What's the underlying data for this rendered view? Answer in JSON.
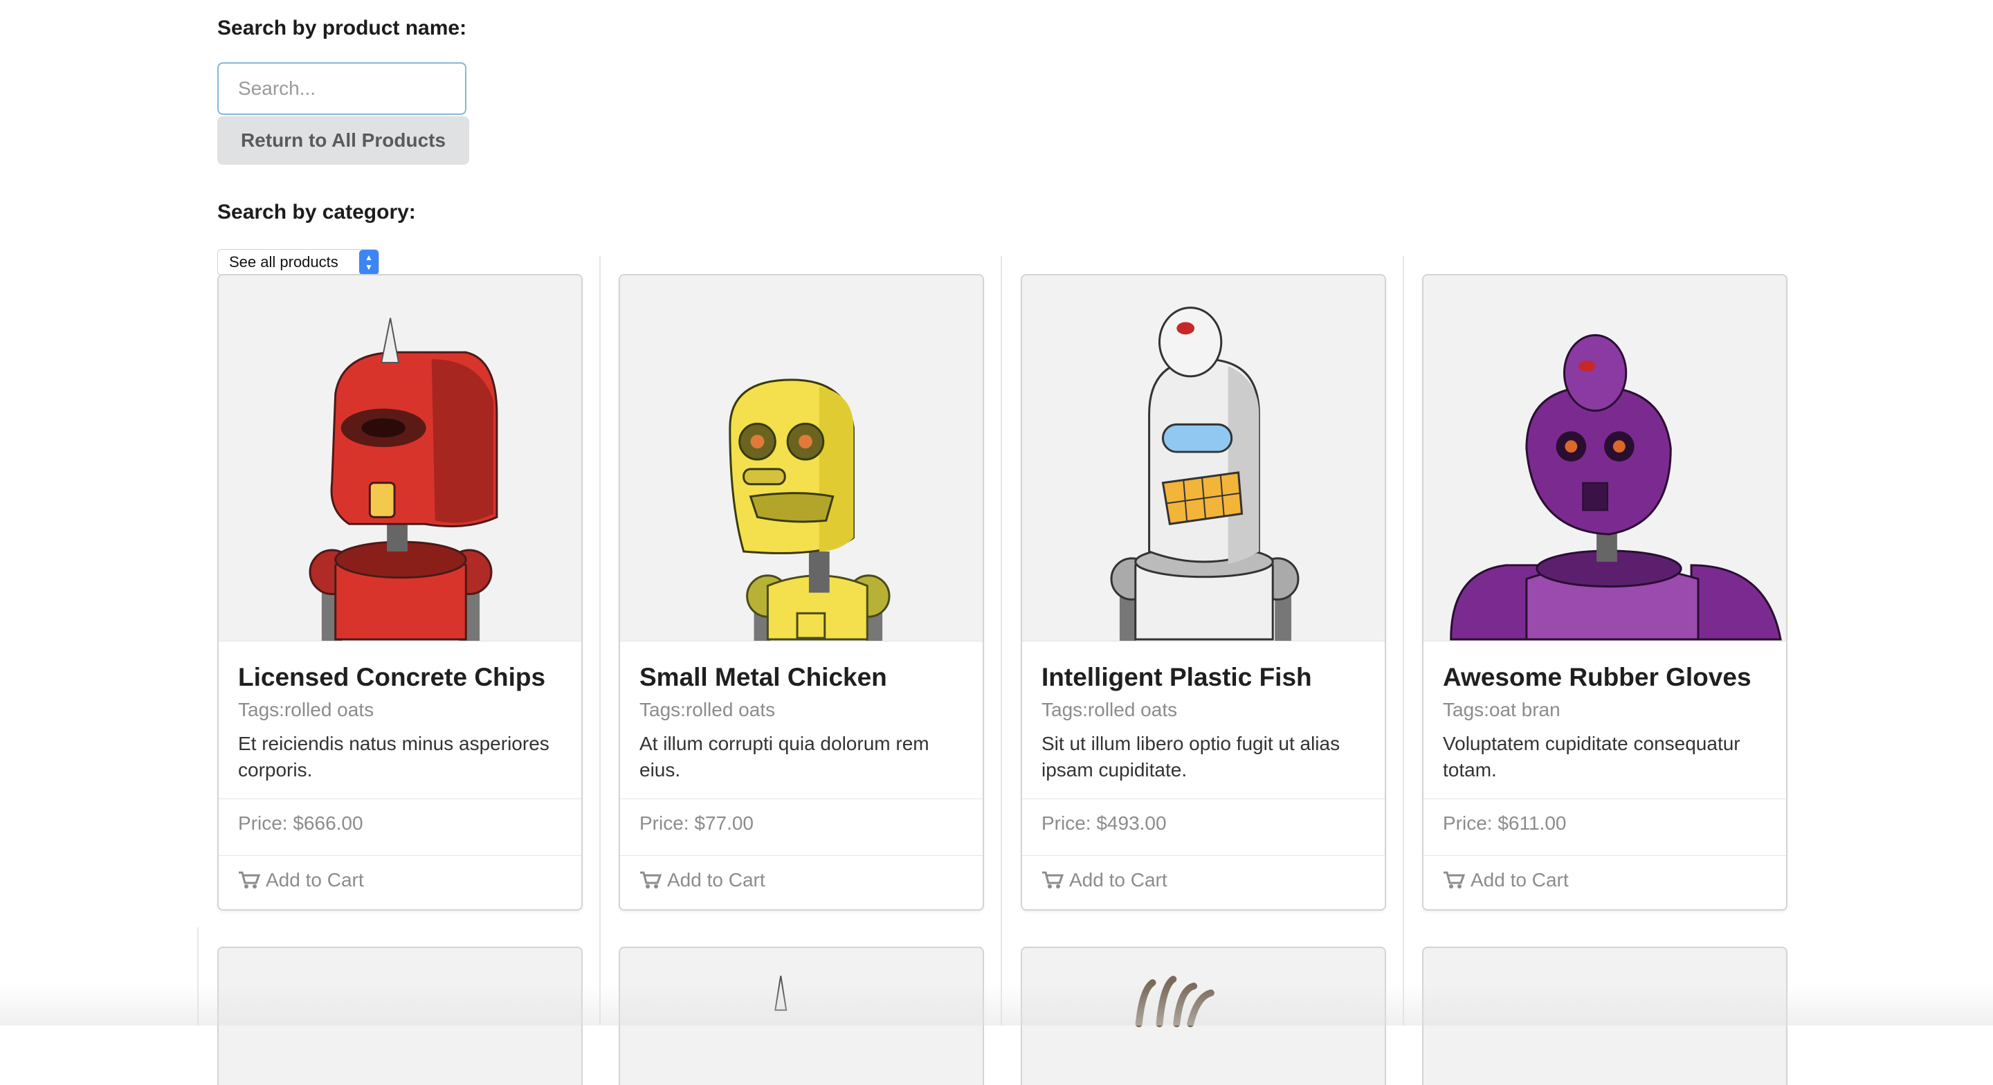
{
  "search": {
    "label": "Search by product name:",
    "placeholder": "Search...",
    "value": "",
    "return_label": "Return to All Products"
  },
  "category": {
    "label": "Search by category:",
    "selected": "See all products"
  },
  "products": [
    {
      "title": "Licensed Concrete Chips",
      "tags": "Tags:rolled oats",
      "description": "Et reiciendis natus minus asperiores corporis.",
      "price": "Price: $666.00",
      "cart_label": "Add to Cart",
      "robot_color": "#d9342b"
    },
    {
      "title": "Small Metal Chicken",
      "tags": "Tags:rolled oats",
      "description": "At illum corrupti quia dolorum rem eius.",
      "price": "Price: $77.00",
      "cart_label": "Add to Cart",
      "robot_color": "#f3e04c"
    },
    {
      "title": "Intelligent Plastic Fish",
      "tags": "Tags:rolled oats",
      "description": "Sit ut illum libero optio fugit ut alias ipsam cupiditate.",
      "price": "Price: $493.00",
      "cart_label": "Add to Cart",
      "robot_color": "#e8e8e8"
    },
    {
      "title": "Awesome Rubber Gloves",
      "tags": "Tags:oat bran",
      "description": "Voluptatem cupiditate consequatur totam.",
      "price": "Price: $611.00",
      "cart_label": "Add to Cart",
      "robot_color": "#7b2b8f"
    }
  ]
}
